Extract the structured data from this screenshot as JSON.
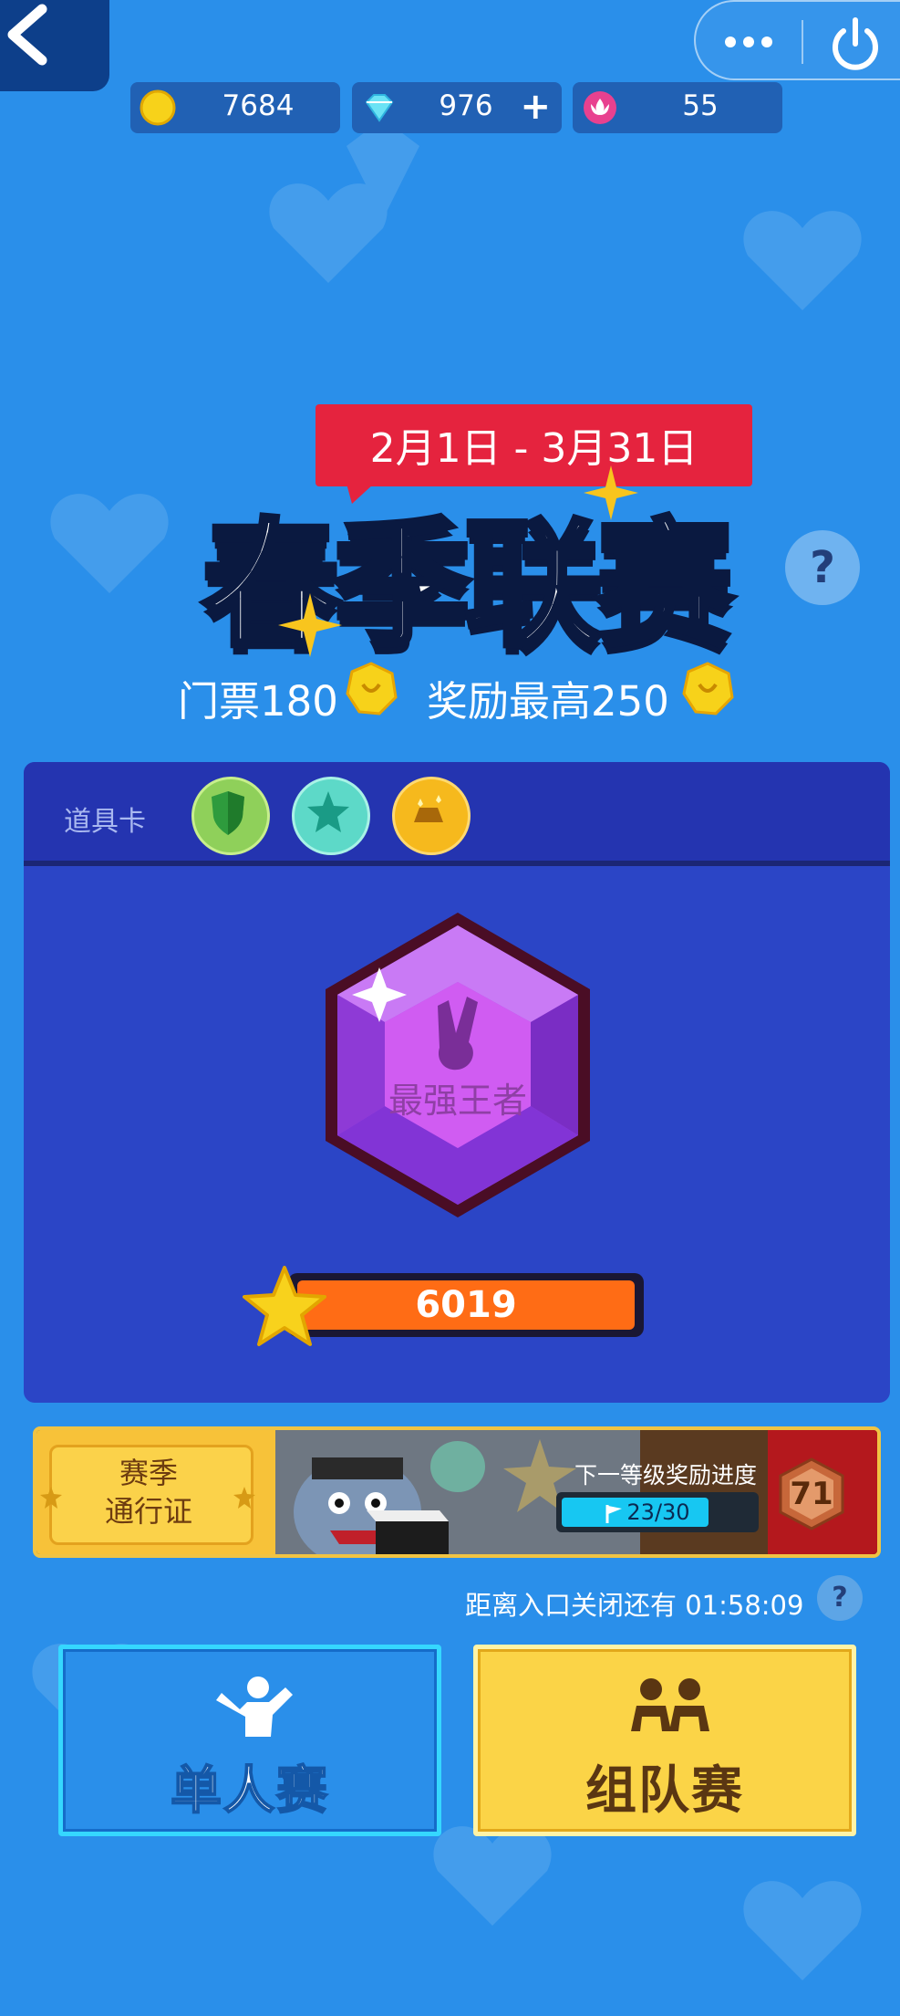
{
  "currencies": {
    "coins": "7684",
    "diamonds": "976",
    "diamond_plus": "+",
    "tickets": "55"
  },
  "event": {
    "dates": "2月1日 - 3月31日",
    "title": "春季联赛",
    "help": "?",
    "ticket_label": "门票180",
    "reward_label": "奖励最高250"
  },
  "props": {
    "label": "道具卡",
    "items": [
      "shield-icon",
      "star-icon",
      "gold-bar-icon"
    ]
  },
  "rank": {
    "name": "最强王者",
    "score": "6019"
  },
  "pass": {
    "title_line1": "赛季",
    "title_line2": "通行证",
    "progress_label": "下一等级奖励进度",
    "progress_text": "23/30",
    "progress_fraction": 0.767,
    "level": "71"
  },
  "countdown": "距离入口关闭还有 01:58:09",
  "modes": {
    "single": "单人赛",
    "team": "组队赛"
  },
  "colors": {
    "background": "#2a8fea",
    "panel": "#2b45c6",
    "accent_red": "#e5233e",
    "score_orange": "#ff6c15",
    "team_yellow": "#fbd447"
  }
}
